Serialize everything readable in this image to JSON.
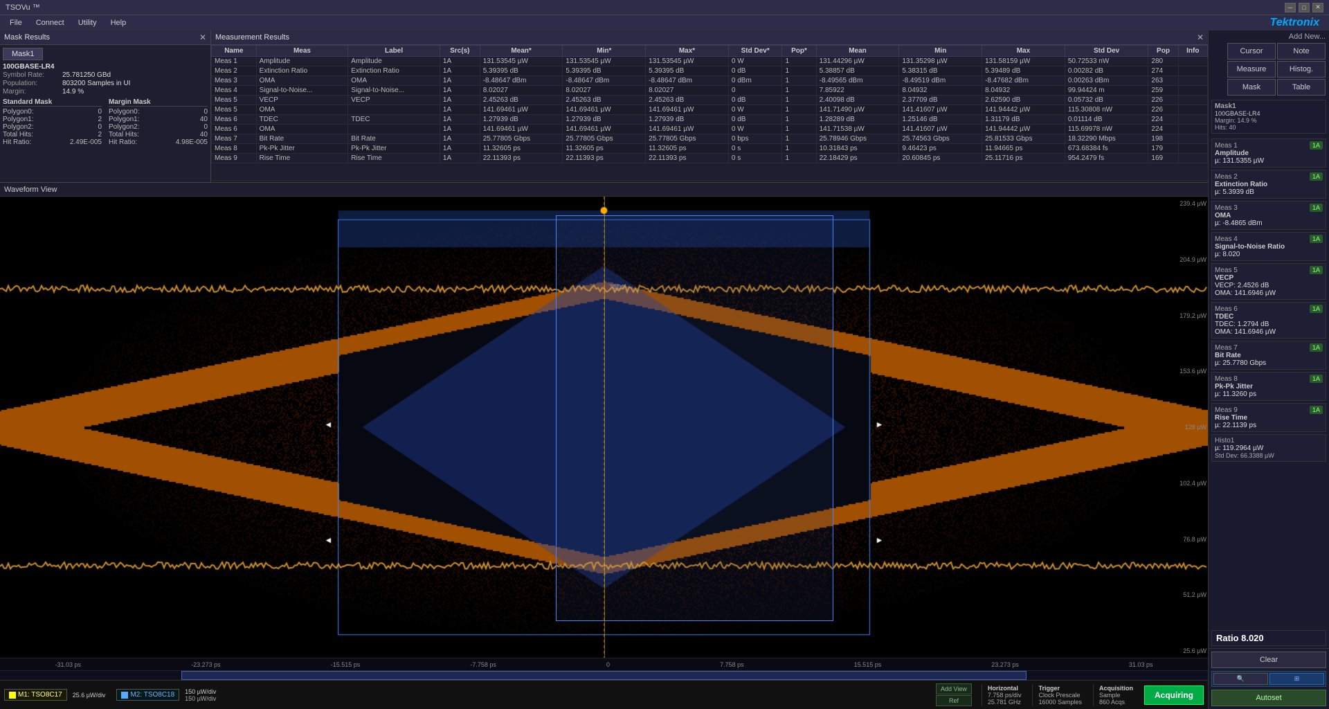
{
  "app": {
    "title": "TSOVu ™",
    "logo": "Tektronix"
  },
  "menu": {
    "items": [
      "File",
      "Connect",
      "Utility",
      "Help"
    ]
  },
  "mask_results": {
    "panel_title": "Mask Results",
    "tab": "Mask1",
    "standard": "100GBASE-LR4",
    "symbol_rate_label": "Symbol Rate:",
    "symbol_rate_value": "25.781250 GBd",
    "population_label": "Population:",
    "population_value": "803200 Samples in UI",
    "margin_label": "Margin:",
    "margin_value": "14.9 %",
    "standard_mask_label": "Standard Mask",
    "margin_mask_label": "Margin Mask",
    "polygon0_label": "Polygon0:",
    "polygon0_std": "0",
    "polygon0_margin": "0",
    "polygon1_label": "Polygon1:",
    "polygon1_std": "2",
    "polygon1_margin": "40",
    "polygon2_label": "Polygon2:",
    "polygon2_std": "0",
    "polygon2_margin": "0",
    "total_hits_label": "Total Hits:",
    "total_hits_std": "2",
    "total_hits_margin": "40",
    "hit_ratio_label": "Hit Ratio:",
    "hit_ratio_std": "2.49E-005",
    "hit_ratio_margin": "4.98E-005"
  },
  "measurement_results": {
    "panel_title": "Measurement Results",
    "columns": [
      "Name",
      "Meas",
      "Label",
      "Src(s)",
      "Mean*",
      "Min*",
      "Max*",
      "Std Dev*",
      "Pop*",
      "Mean",
      "Min",
      "Max",
      "Std Dev",
      "Pop",
      "Info"
    ],
    "rows": [
      [
        "Meas 1",
        "Amplitude",
        "Amplitude",
        "1A",
        "131.53545 µW",
        "131.53545 µW",
        "131.53545 µW",
        "0 W",
        "1",
        "131.44296 µW",
        "131.35298 µW",
        "131.58159 µW",
        "50.72533 nW",
        "280",
        ""
      ],
      [
        "Meas 2",
        "Extinction Ratio",
        "Extinction Ratio",
        "1A",
        "5.39395 dB",
        "5.39395 dB",
        "5.39395 dB",
        "0 dB",
        "1",
        "5.38857 dB",
        "5.38315 dB",
        "5.39489 dB",
        "0.00282 dB",
        "274",
        ""
      ],
      [
        "Meas 3",
        "OMA",
        "OMA",
        "1A",
        "-8.48647 dBm",
        "-8.48647 dBm",
        "-8.48647 dBm",
        "0 dBm",
        "1",
        "-8.49565 dBm",
        "-8.49519 dBm",
        "-8.47682 dBm",
        "0.00263 dBm",
        "263",
        ""
      ],
      [
        "Meas 4",
        "Signal-to-Noise...",
        "Signal-to-Noise...",
        "1A",
        "8.02027",
        "8.02027",
        "8.02027",
        "0",
        "1",
        "7.85922",
        "8.04932",
        "8.04932",
        "99.94424 m",
        "259",
        ""
      ],
      [
        "Meas 5",
        "VECP",
        "VECP",
        "1A",
        "2.45263 dB",
        "2.45263 dB",
        "2.45263 dB",
        "0 dB",
        "1",
        "2.40098 dB",
        "2.37709 dB",
        "2.62590 dB",
        "0.05732 dB",
        "226",
        ""
      ],
      [
        "Meas 5",
        "OMA",
        "",
        "1A",
        "141.69461 µW",
        "141.69461 µW",
        "141.69461 µW",
        "0 W",
        "1",
        "141.71490 µW",
        "141.41607 µW",
        "141.94442 µW",
        "115.30808 nW",
        "226",
        ""
      ],
      [
        "Meas 6",
        "TDEC",
        "TDEC",
        "1A",
        "1.27939 dB",
        "1.27939 dB",
        "1.27939 dB",
        "0 dB",
        "1",
        "1.28289 dB",
        "1.25146 dB",
        "1.31179 dB",
        "0.01114 dB",
        "224",
        ""
      ],
      [
        "Meas 6",
        "OMA",
        "",
        "1A",
        "141.69461 µW",
        "141.69461 µW",
        "141.69461 µW",
        "0 W",
        "1",
        "141.71538 µW",
        "141.41607 µW",
        "141.94442 µW",
        "115.69978 nW",
        "224",
        ""
      ],
      [
        "Meas 7",
        "Bit Rate",
        "Bit Rate",
        "1A",
        "25.77805 Gbps",
        "25.77805 Gbps",
        "25.77805 Gbps",
        "0 bps",
        "1",
        "25.78946 Gbps",
        "25.74563 Gbps",
        "25.81533 Gbps",
        "18.32290 Mbps",
        "198",
        ""
      ],
      [
        "Meas 8",
        "Pk-Pk Jitter",
        "Pk-Pk Jitter",
        "1A",
        "11.32605 ps",
        "11.32605 ps",
        "11.32605 ps",
        "0 s",
        "1",
        "10.31843 ps",
        "9.46423 ps",
        "11.94665 ps",
        "673.68384 fs",
        "179",
        ""
      ],
      [
        "Meas 9",
        "Rise Time",
        "Rise Time",
        "1A",
        "22.11393 ps",
        "22.11393 ps",
        "22.11393 ps",
        "0 s",
        "1",
        "22.18429 ps",
        "20.60845 ps",
        "25.11716 ps",
        "954.2479 fs",
        "169",
        ""
      ]
    ]
  },
  "waveform": {
    "title": "Waveform View",
    "y_labels": [
      "239.4 µW",
      "204.9 µW",
      "179.2 µW",
      "153.6 µW",
      "128 µW",
      "102.4 µW",
      "76.8 µW",
      "51.2 µW",
      "25.6 µW"
    ],
    "time_labels": [
      "-31.03 ps",
      "-23.273 ps",
      "-15.515 ps",
      "-7.758 ps",
      "0",
      "7.758 ps",
      "15.515 ps",
      "23.273 ps",
      "31.03 ps"
    ],
    "time_axis_bottom": [
      "-31.03 ps",
      "-23.273 ps",
      "-15.515 ps",
      "-7.758 ps",
      "0",
      "7.758 ps",
      "15.515 ps",
      "23.273 ps",
      "31.03 ps"
    ]
  },
  "channels": [
    {
      "name": "M1: TSO8C17",
      "color": "#ffff00",
      "active": true,
      "value": "25.6 µW/div",
      "color2": "#ffff00"
    },
    {
      "name": "M2: TSO8C18",
      "color": "#55aaff",
      "value": "150 µW/div",
      "sub_value": "150 µW/div"
    }
  ],
  "horizontal": {
    "title": "Horizontal",
    "value1": "7.758 ps/div",
    "value2": "25.781 GHz"
  },
  "trigger": {
    "title": "Trigger",
    "value": "Clock Prescale",
    "freq": "16000 Samples"
  },
  "acquisition": {
    "title": "Acquisition",
    "mode": "Sample",
    "samples": "860 Acqs"
  },
  "right_panel": {
    "add_new_label": "Add New...",
    "buttons": {
      "cursor": "Cursor",
      "note": "Note",
      "measure": "Measure",
      "histog": "Histog.",
      "mask": "Mask",
      "table": "Table"
    },
    "mask1_section": {
      "title": "Mask1",
      "standard": "100GBASE-LR4",
      "margin": "Margin: 14.9 %",
      "hits": "Hits: 40"
    },
    "ratio_label": "Ratio 8.020",
    "measurements": [
      {
        "id": "Meas 1",
        "badge": "1A",
        "title": "Amplitude",
        "value": "µ: 131.5355 µW"
      },
      {
        "id": "Meas 2",
        "badge": "1A",
        "title": "Extinction Ratio",
        "value": "µ: 5.3939 dB"
      },
      {
        "id": "Meas 3",
        "badge": "1A",
        "title": "OMA",
        "value": "µ: -8.4865 dBm"
      },
      {
        "id": "Meas 4",
        "badge": "1A",
        "title": "Signal-to-Noise Ratio",
        "value": "µ: 8.020"
      },
      {
        "id": "Meas 5",
        "badge": "1A",
        "title": "VECP",
        "value": "VECP: 2.4526 dB\nOMA: 141.6946 µW"
      },
      {
        "id": "Meas 6",
        "badge": "1A",
        "title": "TDEC",
        "value": "TDEC: 1.2794 dB\nOMA: 141.6946 µW"
      },
      {
        "id": "Meas 7",
        "badge": "1A",
        "title": "Bit Rate",
        "value": "µ: 25.7780 Gbps"
      },
      {
        "id": "Meas 8",
        "badge": "1A",
        "title": "Pk-Pk Jitter",
        "value": "µ: 11.3260 ps"
      },
      {
        "id": "Meas 9",
        "badge": "1A",
        "title": "Rise Time",
        "value": "µ: 22.1139 ps"
      }
    ],
    "histo": {
      "id": "Histo1",
      "value": "µ: 119.2964 µW",
      "std": "Std Dev: 66.3388 µW"
    },
    "clear_label": "Clear",
    "autoset_label": "Autoset",
    "acquiring_label": "Acquiring"
  }
}
